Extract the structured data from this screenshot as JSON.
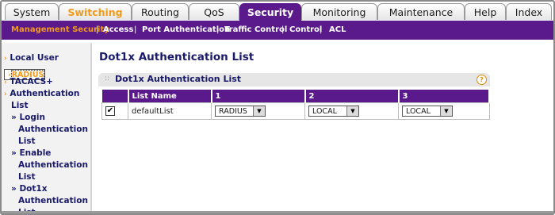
{
  "tabs": [
    {
      "label": "System"
    },
    {
      "label": "Switching"
    },
    {
      "label": "Routing"
    },
    {
      "label": "QoS"
    },
    {
      "label": "Security"
    },
    {
      "label": "Monitoring"
    },
    {
      "label": "Maintenance"
    },
    {
      "label": "Help"
    },
    {
      "label": "Index"
    }
  ],
  "submenu": [
    {
      "label": "Management Security"
    },
    {
      "label": "Access"
    },
    {
      "label": "Port Authentication"
    },
    {
      "label": "Traffic Control"
    },
    {
      "label": "Control"
    },
    {
      "label": "ACL"
    }
  ],
  "separator": "|",
  "sidebar": {
    "items": [
      {
        "text": "Local User"
      },
      {
        "text": "RADIUS"
      },
      {
        "text": "TACACS+"
      },
      {
        "text": "Authentication"
      },
      {
        "text": "List"
      },
      {
        "text": "Login"
      },
      {
        "text": "Authentication"
      },
      {
        "text": "List"
      },
      {
        "text": "Enable"
      },
      {
        "text": "Authentication"
      },
      {
        "text": "List"
      },
      {
        "text": "Dot1x"
      },
      {
        "text": "Authentication"
      },
      {
        "text": "List"
      }
    ],
    "arrow": "›",
    "sub_arrow": "»"
  },
  "page": {
    "title": "Dot1x Authentication List",
    "panel_title": "Dot1x Authentication List",
    "help": "?",
    "columns": [
      "",
      "List Name",
      "1",
      "2",
      "3"
    ],
    "row": {
      "checked": true,
      "check_mark": "✔",
      "name": "defaultList",
      "methods": [
        "RADIUS",
        "LOCAL",
        "LOCAL"
      ]
    },
    "dropdown_arrow": "▼"
  },
  "colors": {
    "accent": "#5b1a8c",
    "highlight": "#f29a1b",
    "link": "#1a1a6a"
  }
}
